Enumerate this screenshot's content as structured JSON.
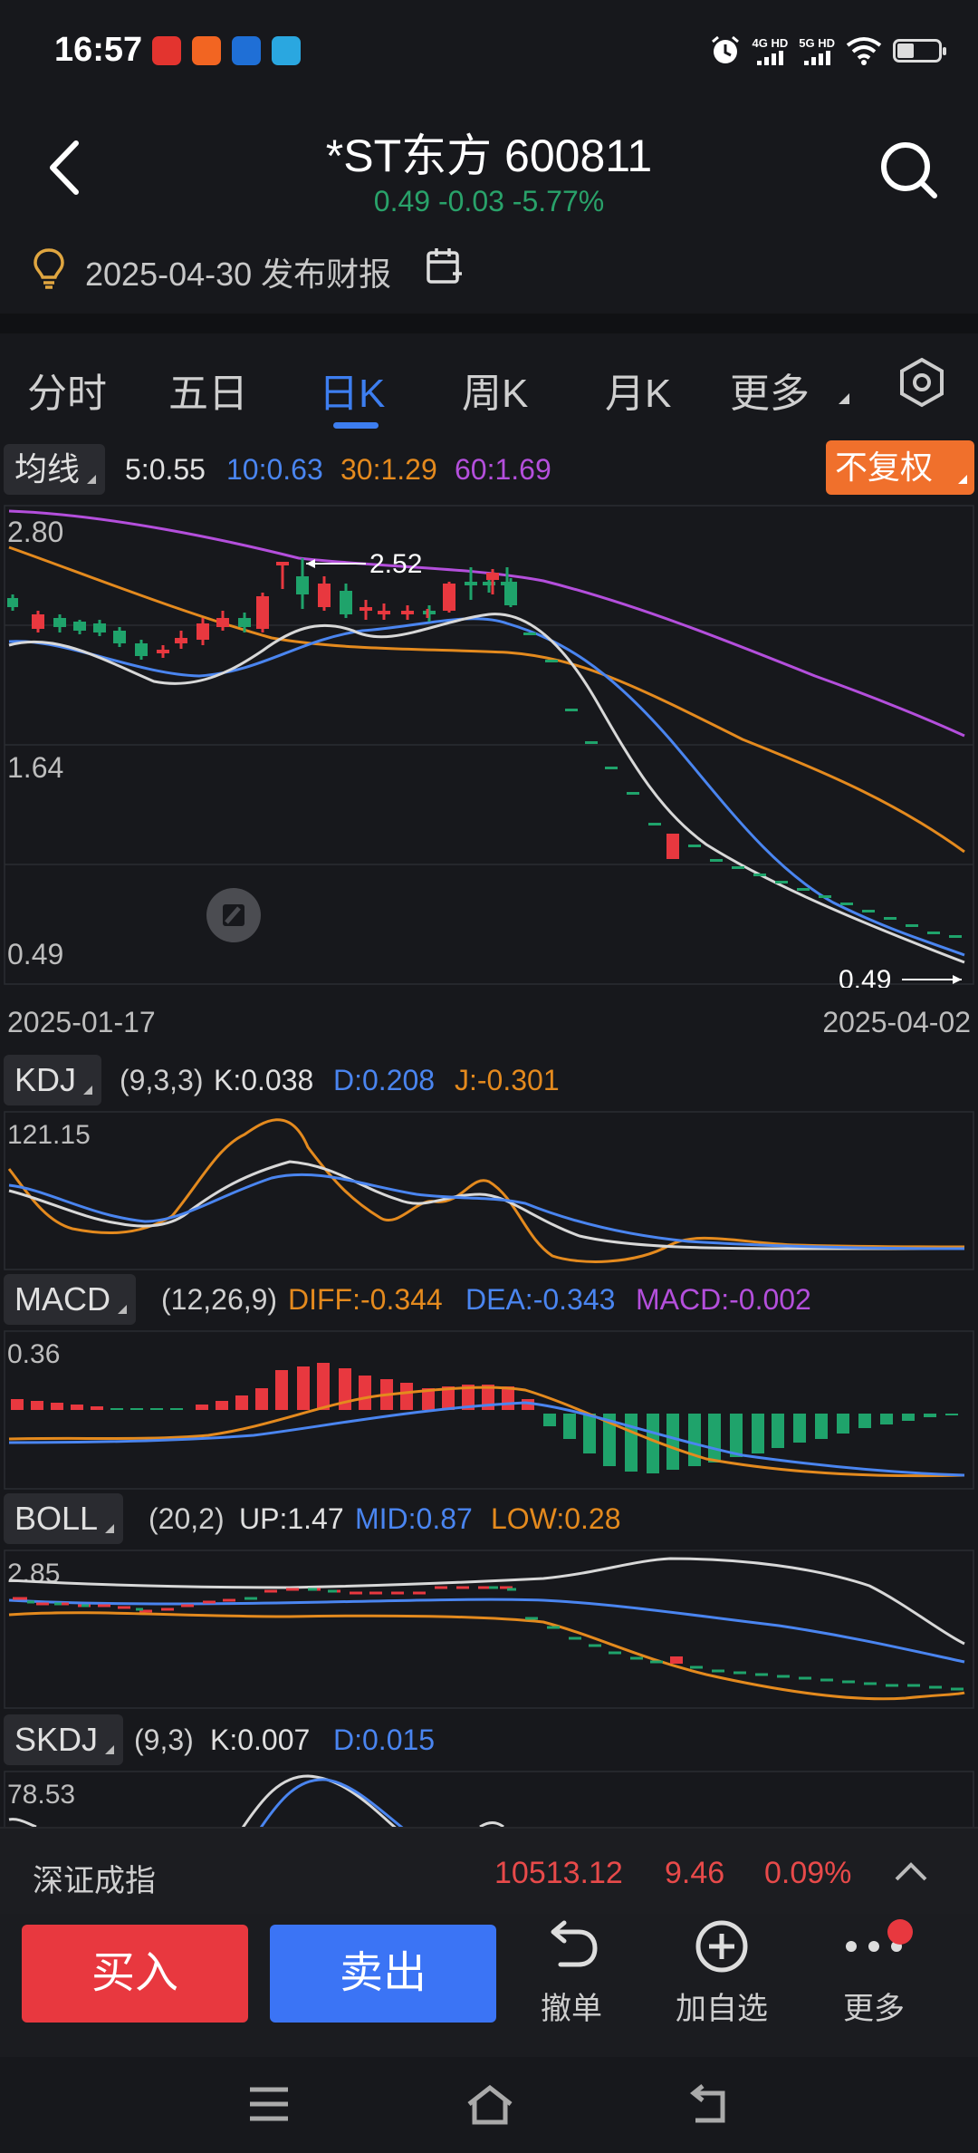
{
  "status": {
    "time": "16:57",
    "signal1": "4G HD",
    "signal2": "5G HD",
    "app_colors": [
      "#e3342f",
      "#f26522",
      "#1f6fd6",
      "#2aa7e0"
    ]
  },
  "header": {
    "title": "*ST东方 600811",
    "quote": "0.49 -0.03 -5.77%",
    "report_notice": "2025-04-30 发布财报"
  },
  "tabs": [
    {
      "label": "分时"
    },
    {
      "label": "五日"
    },
    {
      "label": "日K"
    },
    {
      "label": "周K"
    },
    {
      "label": "月K"
    },
    {
      "label": "更多"
    }
  ],
  "ma": {
    "button": "均线",
    "ma5": "5:0.55",
    "ma10": "10:0.63",
    "ma30": "30:1.29",
    "ma60": "60:1.69",
    "adjust_button": "不复权"
  },
  "price_chart": {
    "y_top": "2.80",
    "y_mid": "1.64",
    "y_bottom": "0.49",
    "high_label": "2.52",
    "low_label": "0.49",
    "date_start": "2025-01-17",
    "date_end": "2025-04-02"
  },
  "kdj": {
    "button": "KDJ",
    "params": "(9,3,3)",
    "k": "K:0.038",
    "d": "D:0.208",
    "j": "J:-0.301",
    "y_top": "121.15"
  },
  "macd": {
    "button": "MACD",
    "params": "(12,26,9)",
    "diff": "DIFF:-0.344",
    "dea": "DEA:-0.343",
    "macd": "MACD:-0.002",
    "y_top": "0.36"
  },
  "boll": {
    "button": "BOLL",
    "params": "(20,2)",
    "up": "UP:1.47",
    "mid": "MID:0.87",
    "low": "LOW:0.28",
    "y_top": "2.85"
  },
  "skdj": {
    "button": "SKDJ",
    "params": "(9,3)",
    "k": "K:0.007",
    "d": "D:0.015",
    "y_top": "78.53"
  },
  "index": {
    "name": "深证成指",
    "value": "10513.12",
    "change": "9.46",
    "pct": "0.09%"
  },
  "actions": {
    "buy": "买入",
    "sell": "卖出",
    "cancel": "撤单",
    "add_watch": "加自选",
    "more": "更多"
  },
  "colors": {
    "up": "#e8383f",
    "down": "#1fa36b",
    "ma5": "#d8d8d8",
    "ma10": "#4a85f0",
    "ma30": "#e48a1e",
    "ma60": "#b44fdc",
    "accent": "#3d7ef0"
  }
}
